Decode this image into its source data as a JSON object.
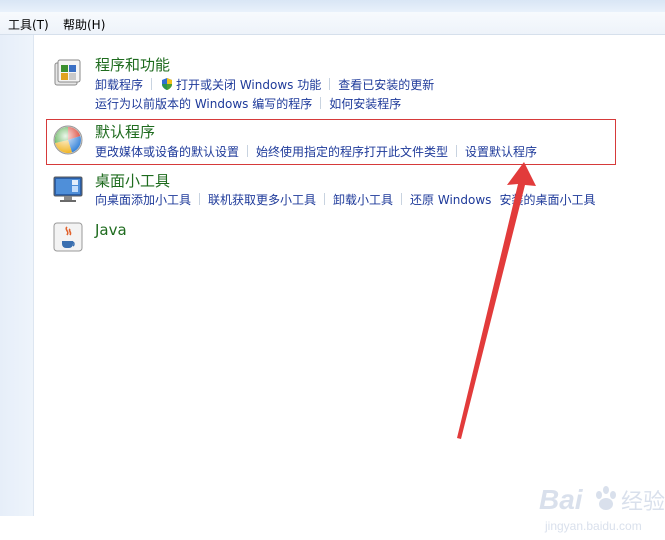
{
  "menu": {
    "tools": "工具(T)",
    "help": "帮助(H)"
  },
  "categories": [
    {
      "title": "程序和功能",
      "icon": "programs-features-icon",
      "line1": [
        "卸载程序",
        "打开或关闭 Windows 功能",
        "查看已安装的更新"
      ],
      "line2": [
        "运行为以前版本的 Windows 编写的程序",
        "如何安装程序"
      ]
    },
    {
      "title": "默认程序",
      "icon": "default-programs-icon",
      "line1": [
        "更改媒体或设备的默认设置",
        "始终使用指定的程序打开此文件类型",
        "设置默认程序"
      ]
    },
    {
      "title": "桌面小工具",
      "icon": "desktop-gadgets-icon",
      "line1": [
        "向桌面添加小工具",
        "联机获取更多小工具",
        "卸载小工具",
        "还原 Windows",
        "安装的桌面小工具"
      ]
    },
    {
      "title": "Java",
      "icon": "java-icon"
    }
  ],
  "watermark": {
    "brand": "Bai",
    "brand2": "经验",
    "url": "jingyan.baidu.com"
  },
  "colors": {
    "highlight": "#d63a3a",
    "title": "#1e6b1e",
    "link": "#1e3a9a"
  }
}
